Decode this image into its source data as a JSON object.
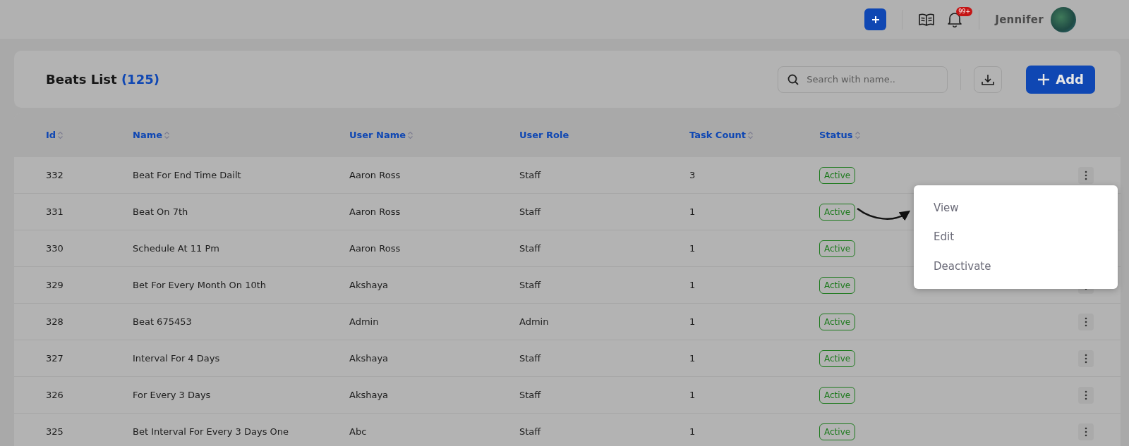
{
  "header": {
    "notification_badge": "99+",
    "user_name": "Jennifer"
  },
  "toolbar": {
    "title": "Beats List",
    "count": "(125)",
    "search": {
      "placeholder": "Search with name.."
    },
    "add_button": "Add"
  },
  "table": {
    "columns": [
      {
        "label": "Id",
        "sortable": true
      },
      {
        "label": "Name",
        "sortable": true
      },
      {
        "label": "User Name",
        "sortable": true
      },
      {
        "label": "User Role",
        "sortable": false
      },
      {
        "label": "Task Count",
        "sortable": true
      },
      {
        "label": "Status",
        "sortable": true
      }
    ],
    "rows": [
      {
        "id": "332",
        "name": "Beat For End Time Dailt",
        "user_name": "Aaron Ross",
        "user_role": "Staff",
        "task_count": "3",
        "status": "Active"
      },
      {
        "id": "331",
        "name": "Beat On 7th",
        "user_name": "Aaron Ross",
        "user_role": "Staff",
        "task_count": "1",
        "status": "Active"
      },
      {
        "id": "330",
        "name": "Schedule At 11 Pm",
        "user_name": "Aaron Ross",
        "user_role": "Staff",
        "task_count": "1",
        "status": "Active"
      },
      {
        "id": "329",
        "name": "Bet For Every Month On 10th",
        "user_name": "Akshaya",
        "user_role": "Staff",
        "task_count": "1",
        "status": "Active"
      },
      {
        "id": "328",
        "name": "Beat 675453",
        "user_name": "Admin",
        "user_role": "Admin",
        "task_count": "1",
        "status": "Active"
      },
      {
        "id": "327",
        "name": "Interval For 4 Days",
        "user_name": "Akshaya",
        "user_role": "Staff",
        "task_count": "1",
        "status": "Active"
      },
      {
        "id": "326",
        "name": "For Every 3 Days",
        "user_name": "Akshaya",
        "user_role": "Staff",
        "task_count": "1",
        "status": "Active"
      },
      {
        "id": "325",
        "name": "Bet Interval For Every 3 Days One",
        "user_name": "Abc",
        "user_role": "Staff",
        "task_count": "1",
        "status": "Active"
      }
    ]
  },
  "action_menu": {
    "items": [
      "View",
      "Edit",
      "Deactivate"
    ]
  }
}
